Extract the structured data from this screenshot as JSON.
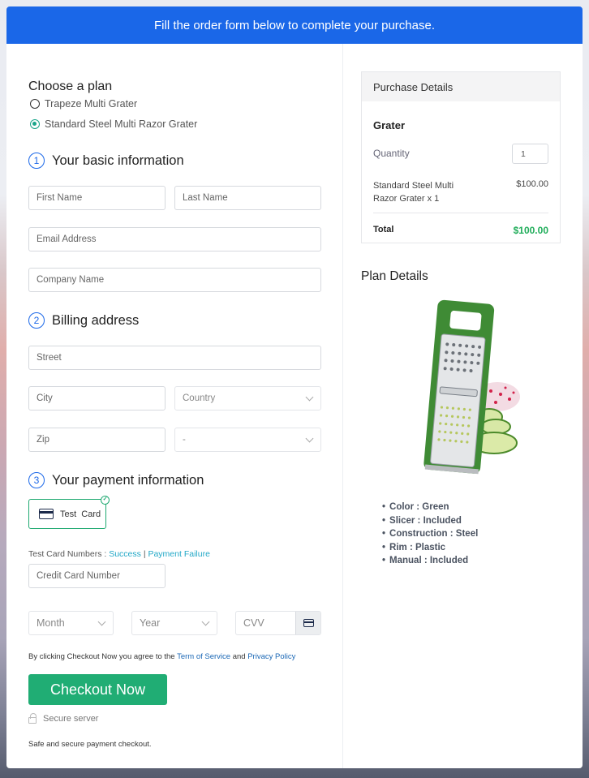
{
  "banner": {
    "text": "Fill the order form below to complete your purchase."
  },
  "plan": {
    "title": "Choose a plan",
    "options": [
      {
        "label": "Trapeze Multi Grater",
        "selected": false
      },
      {
        "label": "Standard Steel Multi Razor Grater",
        "selected": true
      }
    ]
  },
  "basic": {
    "number": "1",
    "title": "Your basic information",
    "first_name_placeholder": "First Name",
    "last_name_placeholder": "Last Name",
    "email_placeholder": "Email Address",
    "company_placeholder": "Company Name"
  },
  "billing": {
    "number": "2",
    "title": "Billing address",
    "street_placeholder": "Street",
    "city_placeholder": "City",
    "country_value": "Country",
    "zip_placeholder": "Zip",
    "state_value": "-"
  },
  "payment": {
    "number": "3",
    "title": "Your payment information",
    "method_label": "Test  Card",
    "test_numbers_label": "Test Card Numbers : ",
    "success_link": "Success",
    "separator": "|",
    "failure_link": "Payment Failure",
    "card_number_placeholder": "Credit Card Number",
    "month_value": "Month",
    "year_value": "Year",
    "cvv_placeholder": "CVV"
  },
  "terms": {
    "prefix": "By clicking Checkout Now you agree to the ",
    "tos_link": "Term of Service",
    "middle": " and ",
    "privacy_link": "Privacy Policy"
  },
  "checkout": {
    "button_label": "Checkout Now",
    "secure_label": "Secure server",
    "safe_text": "Safe and secure payment checkout."
  },
  "purchase": {
    "header": "Purchase Details",
    "product": "Grater",
    "quantity_label": "Quantity",
    "quantity_value": "1",
    "item_label": "Standard Steel Multi Razor Grater x 1",
    "item_price": "$100.00",
    "total_label": "Total",
    "total_value": "$100.00"
  },
  "plan_details": {
    "title": "Plan Details",
    "image_alt": "Green multi grater with cucumber and radish slices",
    "specs": [
      "Color : Green",
      "Slicer : Included",
      "Construction : Steel",
      "Rim : Plastic",
      "Manual : Included"
    ]
  },
  "colors": {
    "banner": "#1a67e8",
    "accent_green": "#20ad74",
    "total_green": "#20ad5a",
    "link_teal": "#22a8c7"
  }
}
